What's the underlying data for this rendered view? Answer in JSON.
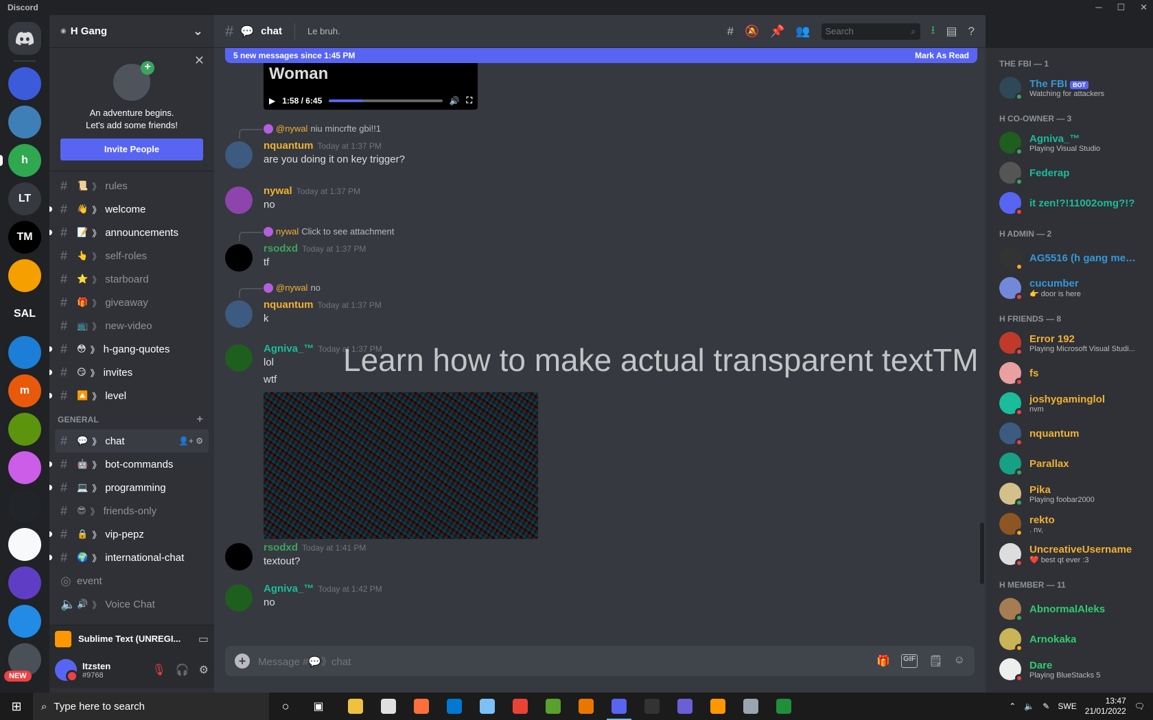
{
  "window": {
    "app_name": "Discord",
    "controls": [
      "─",
      "☐",
      "✕"
    ]
  },
  "guilds": [
    {
      "label": "",
      "color": "#3b5bdb"
    },
    {
      "label": "",
      "color": "#3f7fb8"
    },
    {
      "label": "h",
      "color": "#2fa84f"
    },
    {
      "label": "LT",
      "color": "#36393f"
    },
    {
      "label": "TM",
      "color": "#000000"
    },
    {
      "label": "",
      "color": "#f59f00"
    },
    {
      "label": "SAL",
      "color": "#202225"
    },
    {
      "label": "",
      "color": "#1c7ed6"
    },
    {
      "label": "m",
      "color": "#e8590c"
    },
    {
      "label": "",
      "color": "#5c940d"
    },
    {
      "label": "",
      "color": "#cc5de8"
    },
    {
      "label": "",
      "color": "#212529"
    },
    {
      "label": "",
      "color": "#f8f9fa"
    },
    {
      "label": "",
      "color": "#5f3dc4"
    },
    {
      "label": "",
      "color": "#228be6"
    },
    {
      "label": "",
      "color": "#495057"
    }
  ],
  "new_badge": "NEW",
  "server": {
    "name": "H Gang",
    "chevron": "⌄"
  },
  "invite": {
    "text_line1": "An adventure begins.",
    "text_line2": "Let's add some friends!",
    "button": "Invite People"
  },
  "channels_top": [
    {
      "name": "rules",
      "emoji": "📜",
      "unread": false,
      "icon": "rules-check"
    },
    {
      "name": "welcome",
      "emoji": "👋",
      "unread": true
    },
    {
      "name": "announcements",
      "emoji": "📝",
      "unread": true,
      "icon": "megaphone"
    },
    {
      "name": "self-roles",
      "emoji": "👆",
      "unread": false
    },
    {
      "name": "starboard",
      "emoji": "⭐",
      "unread": false
    },
    {
      "name": "giveaway",
      "emoji": "🎁",
      "unread": false
    },
    {
      "name": "new-video",
      "emoji": "📺",
      "unread": false
    },
    {
      "name": "h-gang-quotes",
      "emoji": "😳",
      "unread": true
    },
    {
      "name": "invites",
      "emoji": "😏",
      "unread": true
    },
    {
      "name": "level",
      "emoji": "🔼",
      "unread": true
    }
  ],
  "category_general": "GENERAL",
  "channels_general": [
    {
      "name": "chat",
      "emoji": "💬",
      "unread": false,
      "active": true
    },
    {
      "name": "bot-commands",
      "emoji": "🤖",
      "unread": true
    },
    {
      "name": "programming",
      "emoji": "💻",
      "unread": true
    },
    {
      "name": "friends-only",
      "emoji": "😎",
      "unread": false
    },
    {
      "name": "vip-pepz",
      "emoji": "🔒",
      "unread": true
    },
    {
      "name": "international-chat",
      "emoji": "🌍",
      "unread": true
    },
    {
      "name": "event",
      "emoji": "",
      "unread": false
    },
    {
      "name": "Voice Chat",
      "emoji": "🔊",
      "unread": false
    }
  ],
  "activity": {
    "name": "Sublime Text (UNREGI..."
  },
  "user": {
    "name": "Itzsten",
    "tag": "#9768"
  },
  "chat_header": {
    "channel": "chat",
    "emoji": "💬",
    "topic": "Le bruh.",
    "search_placeholder": "Search"
  },
  "new_messages_bar": {
    "text": "5 new messages since 1:45 PM",
    "action": "Mark As Read"
  },
  "video": {
    "title": "Woman",
    "time": "1:58 / 6:45",
    "progress": 0.3
  },
  "messages": [
    {
      "reply_user": "@nywal",
      "reply_text": "niu mincrfte gbi!!1",
      "author": "nquantum",
      "author_color": "#f0b132",
      "time": "Today at 1:37 PM",
      "text": "are you doing it on key trigger?",
      "avatar_color": "#3d5a80"
    },
    {
      "reply_user": "",
      "reply_text": "",
      "author": "nywal",
      "author_color": "#f0b132",
      "time": "Today at 1:37 PM",
      "text": "no",
      "avatar_color": "#8e44ad"
    },
    {
      "reply_user": "nywal",
      "reply_text": "Click to see attachment",
      "author": "rsodxd",
      "author_color": "#3ba55d",
      "time": "Today at 1:37 PM",
      "text": "tf",
      "avatar_color": "#000000"
    },
    {
      "reply_user": "@nywal",
      "reply_text": "no",
      "author": "nquantum",
      "author_color": "#f0b132",
      "time": "Today at 1:37 PM",
      "text": "k",
      "avatar_color": "#3d5a80"
    },
    {
      "reply_user": "",
      "reply_text": "",
      "author": "Agniva_™",
      "author_color": "#1abc9c",
      "time": "Today at 1:37 PM",
      "text": "lol",
      "text2": "wtf",
      "avatar_color": "#1e5e1e"
    },
    {
      "reply_user": "",
      "reply_text": "",
      "author": "rsodxd",
      "author_color": "#3ba55d",
      "time": "Today at 1:41 PM",
      "text": "textout?",
      "avatar_color": "#000000"
    },
    {
      "reply_user": "",
      "reply_text": "",
      "author": "Agniva_™",
      "author_color": "#1abc9c",
      "time": "Today at 1:42 PM",
      "text": "no",
      "avatar_color": "#1e5e1e"
    }
  ],
  "overlay_text": "Learn how to make actual transparent textTM",
  "composer": {
    "placeholder": "Message #💬》chat"
  },
  "member_groups": [
    {
      "title": "THE FBI — 1",
      "members": [
        {
          "name": "The FBI",
          "bot": "BOT",
          "status": "Watching for attackers",
          "color": "#3498db",
          "av": "#2f4858",
          "st": "#3ba55d"
        }
      ]
    },
    {
      "title": "H CO-OWNER — 3",
      "members": [
        {
          "name": "Agniva_™",
          "status": "Playing Visual Studio",
          "color": "#1abc9c",
          "av": "#1e5e1e",
          "st": "#3ba55d"
        },
        {
          "name": "Federap",
          "status": "",
          "color": "#1abc9c",
          "av": "#555555",
          "st": "#3ba55d"
        },
        {
          "name": "it zen!?!11002omg?!?",
          "status": "",
          "color": "#1abc9c",
          "av": "#5865f2",
          "st": "#ed4245"
        }
      ]
    },
    {
      "title": "H ADMIN — 2",
      "members": [
        {
          "name": "AG5516 (h gang mem...",
          "status": "",
          "color": "#3498db",
          "av": "#333333",
          "st": "#faa61a"
        },
        {
          "name": "cucumber",
          "status": "👉 door is here",
          "color": "#3498db",
          "av": "#7289da",
          "st": "#ed4245"
        }
      ]
    },
    {
      "title": "H FRIENDS — 8",
      "members": [
        {
          "name": "Error 192",
          "status": "Playing Microsoft Visual Studi...",
          "color": "#f0b132",
          "av": "#c0392b",
          "st": "#ed4245"
        },
        {
          "name": "fs",
          "status": "",
          "color": "#f0b132",
          "av": "#e8a0a0",
          "st": "#ed4245"
        },
        {
          "name": "joshygaminglol",
          "status": "nvm",
          "color": "#f0b132",
          "av": "#1abc9c",
          "st": "#ed4245"
        },
        {
          "name": "nquantum",
          "status": "",
          "color": "#f0b132",
          "av": "#3d5a80",
          "st": "#ed4245"
        },
        {
          "name": "Parallax",
          "status": "",
          "color": "#f0b132",
          "av": "#16a085",
          "st": "#3ba55d"
        },
        {
          "name": "Pika",
          "status": "Playing foobar2000",
          "color": "#f0b132",
          "av": "#d4c08a",
          "st": "#3ba55d"
        },
        {
          "name": "rekto",
          "status": ". nv,",
          "color": "#f0b132",
          "av": "#8d5524",
          "st": "#faa61a"
        },
        {
          "name": "UncreativeUsername",
          "status": "❤️ best qt ever :3",
          "color": "#f0b132",
          "av": "#dddddd",
          "st": "#ed4245"
        }
      ]
    },
    {
      "title": "H MEMBER — 11",
      "members": [
        {
          "name": "AbnormalAleks",
          "status": "",
          "color": "#2ecc71",
          "av": "#a67c52",
          "st": "#3ba55d"
        },
        {
          "name": "Arnokaka",
          "status": "",
          "color": "#2ecc71",
          "av": "#c9b458",
          "st": "#faa61a"
        },
        {
          "name": "Dare",
          "status": "Playing BlueStacks 5",
          "color": "#2ecc71",
          "av": "#eeeeee",
          "st": "#ed4245"
        }
      ]
    }
  ],
  "taskbar": {
    "search_placeholder": "Type here to search",
    "apps": [
      "#f0c040",
      "#e0e0e0",
      "#ff6f3c",
      "#0078d4",
      "#7bc1f7",
      "#ea4335",
      "#5aa02c",
      "#ea7600",
      "#5865f2",
      "#333333",
      "#6b5fd6",
      "#ff9800",
      "#9aa5b1",
      "#1f8f3a"
    ],
    "lang": "SWE",
    "time": "13:47",
    "date": "21/01/2022"
  }
}
